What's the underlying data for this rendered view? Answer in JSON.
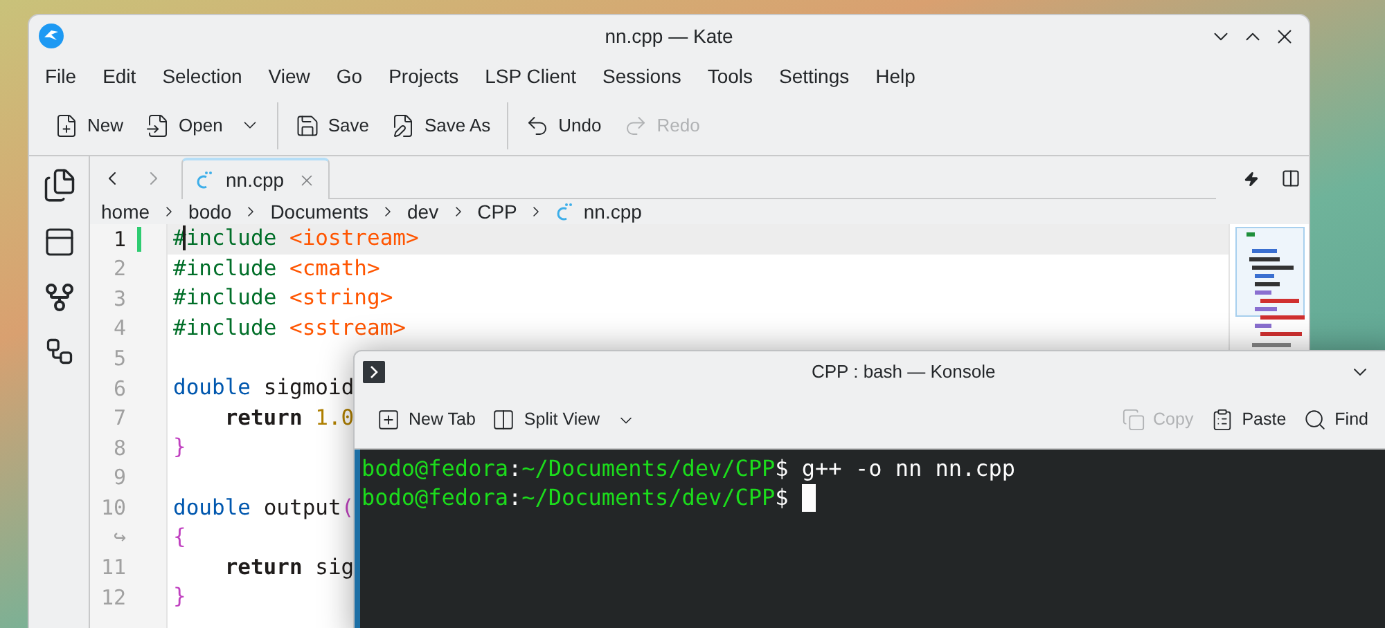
{
  "kate": {
    "title": "nn.cpp — Kate",
    "menu": [
      "File",
      "Edit",
      "Selection",
      "View",
      "Go",
      "Projects",
      "LSP Client",
      "Sessions",
      "Tools",
      "Settings",
      "Help"
    ],
    "toolbar": [
      {
        "kind": "new",
        "label": "New",
        "disabled": false,
        "dropdown": false
      },
      {
        "kind": "open",
        "label": "Open",
        "disabled": false,
        "dropdown": true
      },
      {
        "kind": "separator"
      },
      {
        "kind": "save",
        "label": "Save",
        "disabled": false,
        "dropdown": false
      },
      {
        "kind": "save_as",
        "label": "Save As",
        "disabled": false,
        "dropdown": false
      },
      {
        "kind": "separator"
      },
      {
        "kind": "undo",
        "label": "Undo",
        "disabled": false,
        "dropdown": false
      },
      {
        "kind": "redo",
        "label": "Redo",
        "disabled": true,
        "dropdown": false
      }
    ],
    "tabs": [
      {
        "label": "nn.cpp",
        "selected": true
      }
    ],
    "breadcrumb": [
      "home",
      "bodo",
      "Documents",
      "dev",
      "CPP",
      "nn.cpp"
    ],
    "lines": [
      {
        "gutter": "1",
        "current": true,
        "modified": true,
        "tokens": [
          {
            "kind": "preproc",
            "text": "#"
          },
          {
            "kind": "preproc",
            "text": "include ",
            "caret": true
          },
          {
            "kind": "include",
            "text": "<iostream>"
          }
        ]
      },
      {
        "gutter": "2",
        "current": false,
        "modified": false,
        "tokens": [
          {
            "kind": "preproc",
            "text": "#include "
          },
          {
            "kind": "include",
            "text": "<cmath>"
          }
        ]
      },
      {
        "gutter": "3",
        "current": false,
        "modified": false,
        "tokens": [
          {
            "kind": "preproc",
            "text": "#include "
          },
          {
            "kind": "include",
            "text": "<string>"
          }
        ]
      },
      {
        "gutter": "4",
        "current": false,
        "modified": false,
        "tokens": [
          {
            "kind": "preproc",
            "text": "#include "
          },
          {
            "kind": "include",
            "text": "<sstream>"
          }
        ]
      },
      {
        "gutter": "5",
        "current": false,
        "modified": false
      },
      {
        "gutter": "6",
        "current": false,
        "modified": false,
        "tokens": [
          {
            "kind": "type",
            "text": "double"
          },
          {
            "kind": "plain",
            "text": " sigmoid"
          }
        ]
      },
      {
        "gutter": "7",
        "current": false,
        "modified": false,
        "indented": true,
        "tokens": [
          {
            "kind": "control",
            "text": "return"
          },
          {
            "kind": "number",
            "text": " 1.0"
          }
        ]
      },
      {
        "gutter": "8",
        "current": false,
        "modified": false,
        "tokens": [
          {
            "kind": "brace",
            "text": "}"
          }
        ]
      },
      {
        "gutter": "9",
        "current": false,
        "modified": false
      },
      {
        "gutter": "10",
        "current": false,
        "modified": false,
        "tokens": [
          {
            "kind": "type",
            "text": "double"
          },
          {
            "kind": "plain",
            "text": " output"
          },
          {
            "kind": "brace",
            "text": "("
          }
        ]
      },
      {
        "gutter": "↪",
        "current": false,
        "modified": false,
        "tokens": [
          {
            "kind": "brace",
            "text": "{"
          }
        ]
      },
      {
        "gutter": "11",
        "current": false,
        "modified": false,
        "indented": true,
        "tokens": [
          {
            "kind": "control",
            "text": "return"
          },
          {
            "kind": "plain",
            "text": " sig"
          }
        ]
      },
      {
        "gutter": "12",
        "current": false,
        "modified": false,
        "tokens": [
          {
            "kind": "brace",
            "text": "}"
          }
        ]
      }
    ]
  },
  "konsole": {
    "title": "CPP : bash — Konsole",
    "toolbar": [
      {
        "kind": "new_tab",
        "label": "New Tab",
        "disabled": false,
        "dropdown": false
      },
      {
        "kind": "split",
        "label": "Split View",
        "disabled": false,
        "dropdown": true
      },
      {
        "kind": "copy",
        "label": "Copy",
        "disabled": true,
        "dropdown": false
      },
      {
        "kind": "paste",
        "label": "Paste",
        "disabled": false,
        "dropdown": false
      },
      {
        "kind": "find",
        "label": "Find",
        "disabled": false,
        "dropdown": false
      }
    ],
    "lines": [
      {
        "cursor": false,
        "segments": [
          {
            "kind": "prompt",
            "text": "bodo@fedora"
          },
          {
            "kind": "sep",
            "text": ":"
          },
          {
            "kind": "prompt",
            "text": "~/Documents/dev/CPP"
          },
          {
            "kind": "sep",
            "text": "$ g++ -o nn nn.cpp"
          }
        ]
      },
      {
        "cursor": true,
        "segments": [
          {
            "kind": "prompt",
            "text": "bodo@fedora"
          },
          {
            "kind": "sep",
            "text": ":"
          },
          {
            "kind": "prompt",
            "text": "~/Documents/dev/CPP"
          },
          {
            "kind": "sep",
            "text": "$ "
          }
        ]
      }
    ]
  }
}
